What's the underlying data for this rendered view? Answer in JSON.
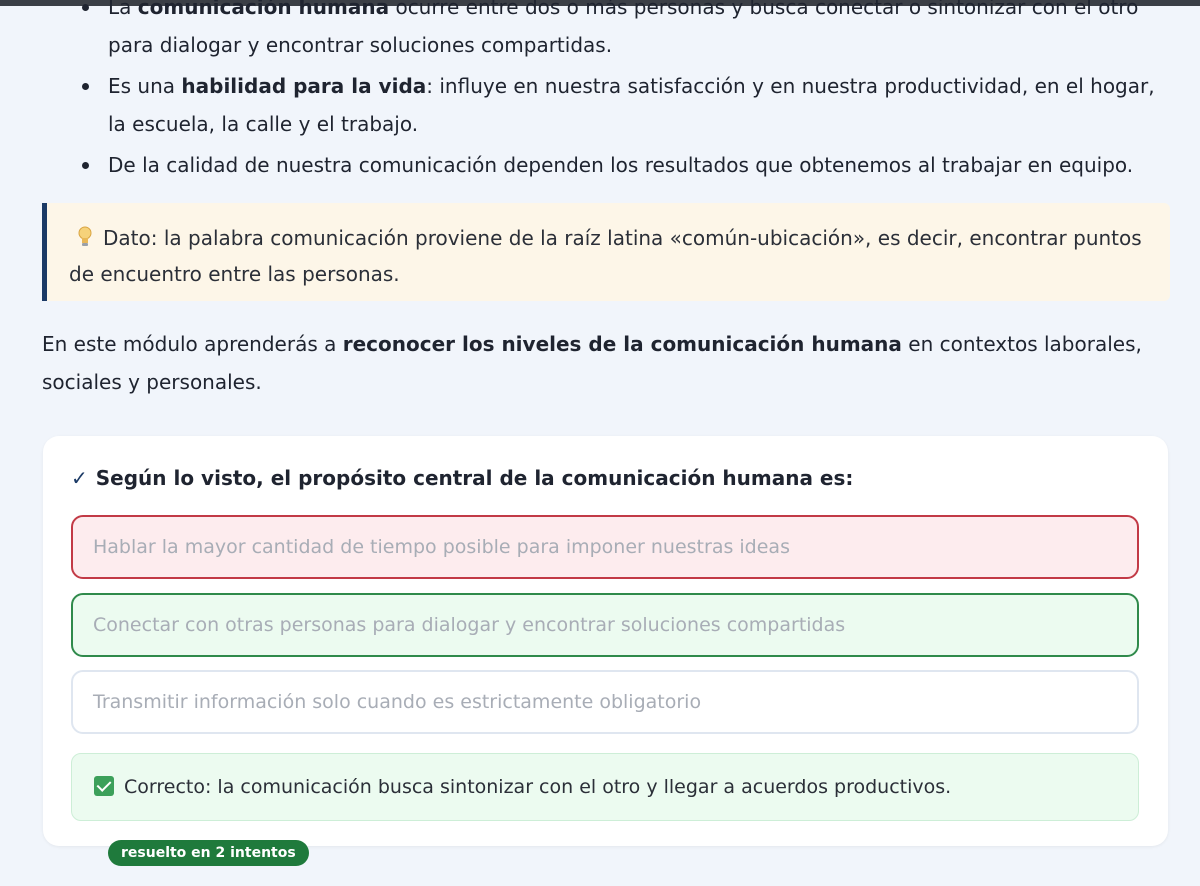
{
  "bullets": [
    {
      "pre": "La ",
      "bold": "comunicación humana",
      "post": " ocurre entre dos o más personas y busca conectar o sintonizar con el otro para dialogar y encontrar soluciones compartidas."
    },
    {
      "pre": "Es una ",
      "bold": "habilidad para la vida",
      "post": ": influye en nuestra satisfacción y en nuestra productividad, en el hogar, la escuela, la calle y el trabajo."
    },
    {
      "pre": "",
      "bold": "",
      "post": "De la calidad de nuestra comunicación dependen los resultados que obtenemos al trabajar en equipo."
    }
  ],
  "tip": {
    "icon": "lightbulb-icon",
    "text": "Dato: la palabra comunicación proviene de la raíz latina «común-ubicación», es decir, encontrar puntos de encuentro entre las personas."
  },
  "intro": {
    "pre": "En este módulo aprenderás a ",
    "bold": "reconocer los niveles de la comunicación humana",
    "post": " en contextos laborales, sociales y personales."
  },
  "quiz": {
    "check": "✓",
    "question": "Según lo visto, el propósito central de la comunicación humana es:",
    "options": [
      {
        "label": "Hablar la mayor cantidad de tiempo posible para imponer nuestras ideas",
        "state": "wrong"
      },
      {
        "label": "Conectar con otras personas para dialogar y encontrar soluciones compartidas",
        "state": "correct"
      },
      {
        "label": "Transmitir información solo cuando es estrictamente obligatorio",
        "state": "neutral"
      }
    ],
    "feedback": {
      "icon": "checkbox-checked-icon",
      "text": "Correcto: la comunicación busca sintonizar con el otro y llegar a acuerdos productivos.",
      "badge": "resuelto en 2 intentos"
    }
  },
  "colors": {
    "background": "#f1f5fb",
    "accent": "#1b3a66",
    "wrong": "#c23a46",
    "correct": "#2f8a4b",
    "badge": "#1f7a3c"
  }
}
